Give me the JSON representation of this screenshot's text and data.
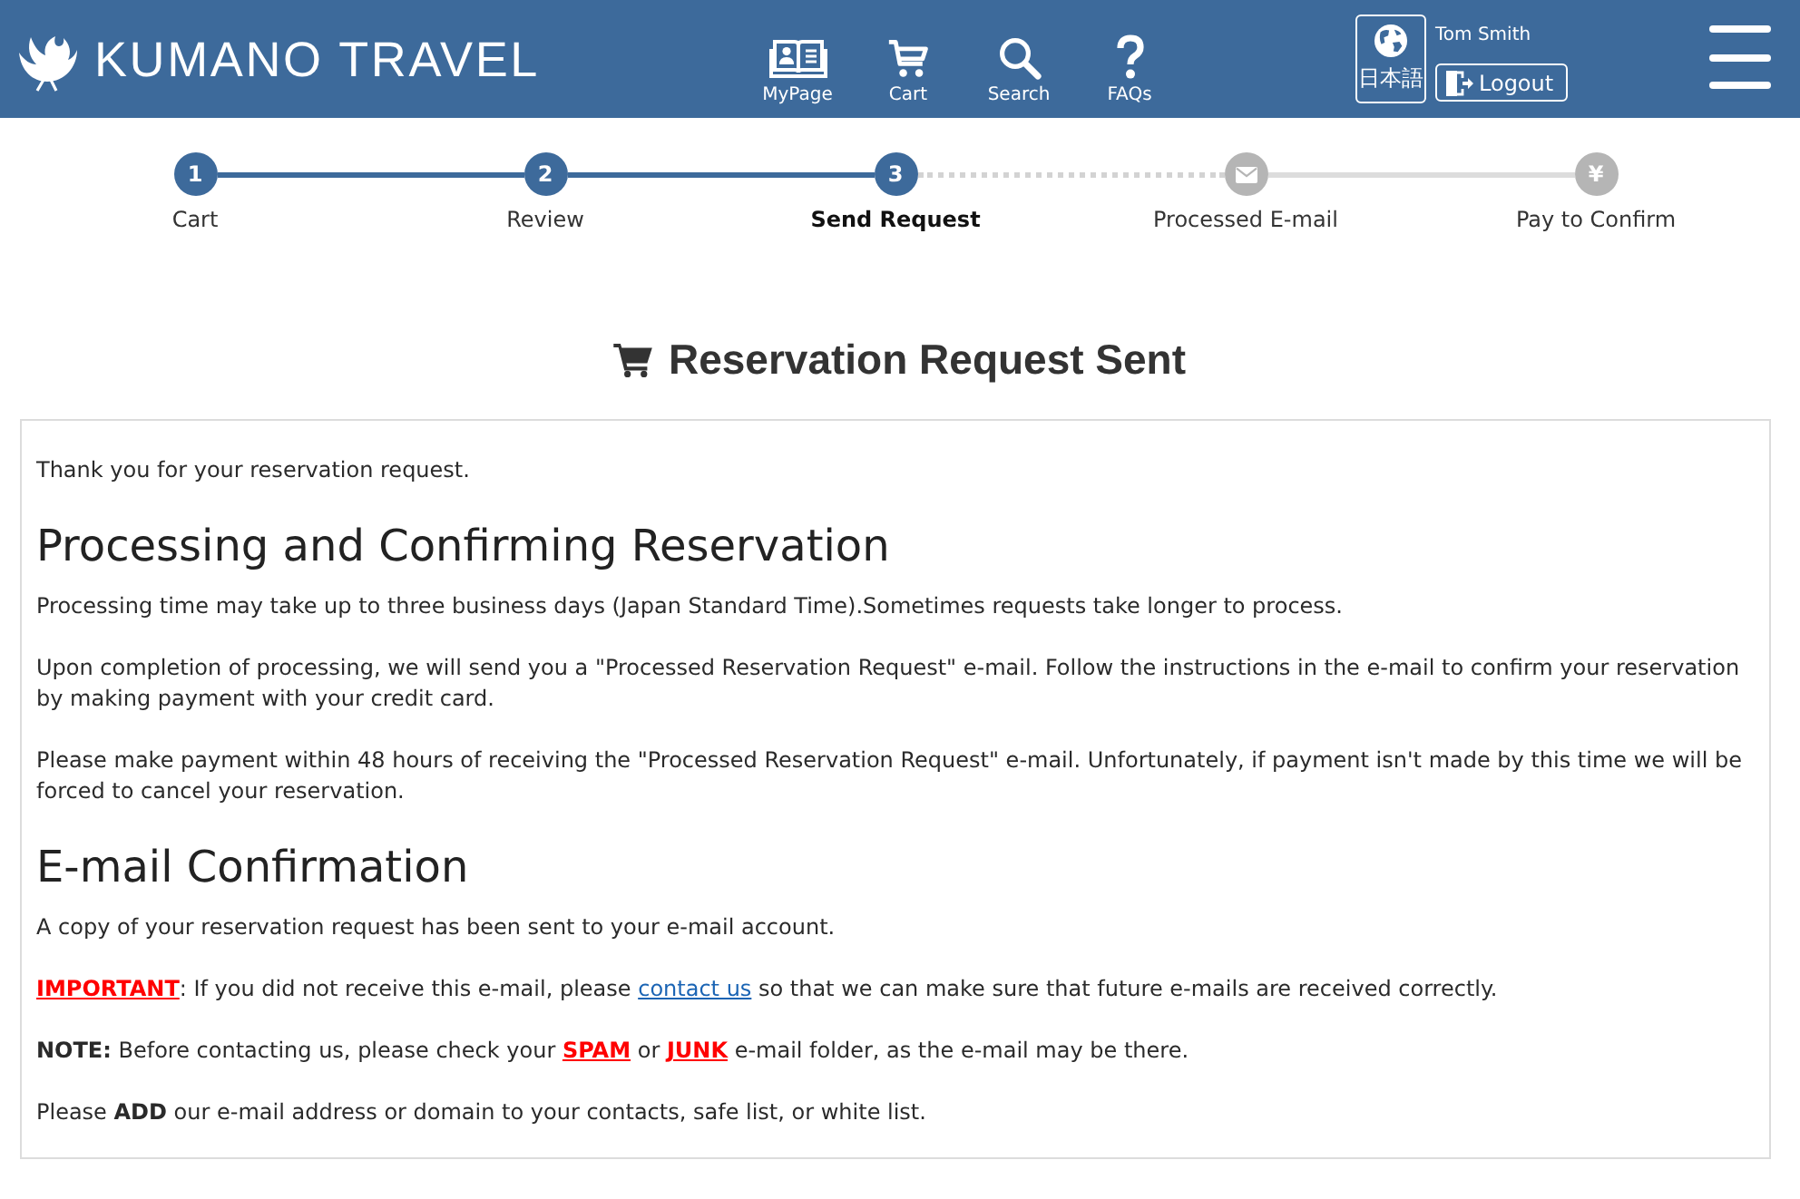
{
  "header": {
    "logo": "KUMANO TRAVEL",
    "nav": [
      "MyPage",
      "Cart",
      "Search",
      "FAQs"
    ],
    "language_button": "日本語",
    "user_name": "Tom Smith",
    "logout_button": "Logout"
  },
  "steps": [
    {
      "label": "Cart",
      "marker": "1",
      "selected": false
    },
    {
      "label": "Review",
      "marker": "2",
      "selected": false
    },
    {
      "label": "Send Request",
      "marker": "3",
      "selected": true
    },
    {
      "label": "Processed E-mail",
      "selected": false
    },
    {
      "label": "Pay to Confirm",
      "marker": "¥",
      "selected": false
    }
  ],
  "title": "Reservation Request Sent",
  "message": {
    "blocks": [
      {
        "kind": "paragraph",
        "text": "Thank you for your reservation request."
      },
      {
        "kind": "heading",
        "text": "Processing and Confirming Reservation"
      },
      {
        "kind": "paragraph",
        "text": "Processing time may take up to three business days (Japan Standard Time).Sometimes requests take longer to process."
      },
      {
        "kind": "paragraph",
        "text": "Upon completion of processing, we will send you a \"Processed Reservation Request\" e-mail. Follow the instructions in the e-mail to confirm your reservation by making payment with your credit card."
      },
      {
        "kind": "paragraph",
        "text": "Please make payment within 48 hours of receiving the \"Processed Reservation Request\" e-mail. Unfortunately, if payment isn't made by this time we will be forced to cancel your reservation."
      },
      {
        "kind": "heading",
        "text": "E-mail Confirmation"
      },
      {
        "kind": "paragraph",
        "text": "A copy of your reservation request has been sent to your e-mail account."
      },
      {
        "kind": "paragraph",
        "parts": [
          {
            "kind": "alert",
            "text": "IMPORTANT"
          },
          {
            "kind": "text",
            "text": ": If you did not receive this e-mail, please "
          },
          {
            "kind": "link",
            "text": "contact us"
          },
          {
            "kind": "text",
            "text": " so that we can make sure that future e-mails are received correctly."
          }
        ]
      },
      {
        "kind": "paragraph",
        "parts": [
          {
            "kind": "text",
            "text": "**NOTE:** Before contacting us, please check your "
          },
          {
            "kind": "alert",
            "text": "SPAM"
          },
          {
            "kind": "text",
            "text": " or "
          },
          {
            "kind": "alert",
            "text": "JUNK"
          },
          {
            "kind": "text",
            "text": " e-mail folder, as the e-mail may be there."
          }
        ]
      },
      {
        "kind": "paragraph",
        "text": "Please **ADD** our e-mail address or domain to your contacts, safe list, or white list."
      }
    ]
  }
}
